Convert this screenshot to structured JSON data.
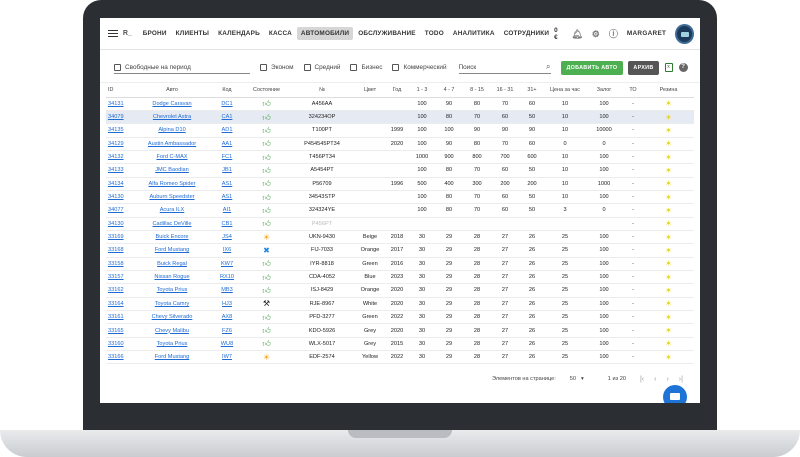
{
  "brand": "R_",
  "nav": [
    "БРОНИ",
    "КЛИЕНТЫ",
    "КАЛЕНДАРЬ",
    "КАССА",
    "АВТОМОБИЛИ",
    "ОБСЛУЖИВАНИЕ",
    "TODO",
    "АНАЛИТИКА",
    "СОТРУДНИКИ"
  ],
  "nav_active": "АВТОМОБИЛИ",
  "top_right": {
    "money": "0 €",
    "user": "MARGARET"
  },
  "filters": {
    "period_placeholder": "Свободные на период",
    "checkboxes": [
      "Эконом",
      "Средний",
      "Бизнес",
      "Коммерческий"
    ],
    "search_placeholder": "Поиск",
    "add_button": "ДОБАВИТЬ АВТО",
    "archive_button": "АРХИВ"
  },
  "columns": [
    "ID",
    "Авто",
    "Код",
    "Состояние",
    "№",
    "Цвет",
    "Год",
    "1 - 3",
    "4 - 7",
    "8 - 15",
    "16 - 31",
    "31+",
    "Цена за час",
    "Залог",
    "ТО",
    "Резина"
  ],
  "rows": [
    {
      "id": "34131",
      "auto": "Dodge Caravan",
      "code": "DC1",
      "state": "up",
      "num": "A456AA",
      "color": "",
      "year": "",
      "p1": "100",
      "p2": "90",
      "p3": "80",
      "p4": "70",
      "p5": "60",
      "hour": "10",
      "deposit": "100",
      "to": "-",
      "selected": false
    },
    {
      "id": "34079",
      "auto": "Chevrolet Astra",
      "code": "CA1",
      "state": "up",
      "num": "324234OP",
      "color": "",
      "year": "",
      "p1": "100",
      "p2": "80",
      "p3": "70",
      "p4": "60",
      "p5": "50",
      "hour": "10",
      "deposit": "100",
      "to": "-",
      "selected": true
    },
    {
      "id": "34135",
      "auto": "Alpina D10",
      "code": "AD1",
      "state": "up",
      "num": "T100PT",
      "color": "",
      "year": "1999",
      "p1": "100",
      "p2": "100",
      "p3": "90",
      "p4": "90",
      "p5": "90",
      "hour": "10",
      "deposit": "10000",
      "to": "-",
      "selected": false
    },
    {
      "id": "34129",
      "auto": "Austin Ambassador",
      "code": "AA1",
      "state": "up",
      "num": "P454545PT34",
      "color": "",
      "year": "2020",
      "p1": "100",
      "p2": "90",
      "p3": "80",
      "p4": "70",
      "p5": "60",
      "hour": "0",
      "deposit": "0",
      "to": "-",
      "selected": false
    },
    {
      "id": "34132",
      "auto": "Ford C-MAX",
      "code": "FC1",
      "state": "up",
      "num": "T456PT34",
      "color": "",
      "year": "",
      "p1": "1000",
      "p2": "900",
      "p3": "800",
      "p4": "700",
      "p5": "600",
      "hour": "10",
      "deposit": "100",
      "to": "-",
      "selected": false
    },
    {
      "id": "34133",
      "auto": "JMC Baodian",
      "code": "JB1",
      "state": "up",
      "num": "A5454PT",
      "color": "",
      "year": "",
      "p1": "100",
      "p2": "80",
      "p3": "70",
      "p4": "60",
      "p5": "50",
      "hour": "10",
      "deposit": "100",
      "to": "-",
      "selected": false
    },
    {
      "id": "34134",
      "auto": "Alfa Romeo Spider",
      "code": "AS1",
      "state": "up",
      "num": "P56709",
      "color": "",
      "year": "1996",
      "p1": "500",
      "p2": "400",
      "p3": "300",
      "p4": "200",
      "p5": "200",
      "hour": "10",
      "deposit": "1000",
      "to": "-",
      "selected": false
    },
    {
      "id": "34130",
      "auto": "Auburn Speedster",
      "code": "AS1",
      "state": "up",
      "num": "34543STP",
      "color": "",
      "year": "",
      "p1": "100",
      "p2": "80",
      "p3": "70",
      "p4": "60",
      "p5": "50",
      "hour": "10",
      "deposit": "100",
      "to": "-",
      "selected": false
    },
    {
      "id": "34077",
      "auto": "Acura ILX",
      "code": "AI1",
      "state": "up",
      "num": "324324YE",
      "color": "",
      "year": "",
      "p1": "100",
      "p2": "80",
      "p3": "70",
      "p4": "60",
      "p5": "50",
      "hour": "3",
      "deposit": "0",
      "to": "-",
      "selected": false
    },
    {
      "id": "34130",
      "auto": "Cadillac DeVille",
      "code": "CB1",
      "state": "up",
      "num": "P456PT",
      "color": "",
      "year": "",
      "p1": "",
      "p2": "",
      "p3": "",
      "p4": "",
      "p5": "",
      "hour": "",
      "deposit": "",
      "to": "-",
      "selected": false,
      "muted": true
    },
    {
      "id": "33169",
      "auto": "Buick Encore",
      "code": "JS4",
      "state": "sun",
      "num": "UKN-9430",
      "color": "Beige",
      "year": "2018",
      "p1": "30",
      "p2": "29",
      "p3": "28",
      "p4": "27",
      "p5": "26",
      "hour": "25",
      "deposit": "100",
      "to": "-",
      "selected": false
    },
    {
      "id": "33168",
      "auto": "Ford Mustang",
      "code": "IX6",
      "state": "wrench",
      "num": "FIJ-7033",
      "color": "Orange",
      "year": "2017",
      "p1": "30",
      "p2": "29",
      "p3": "28",
      "p4": "27",
      "p5": "26",
      "hour": "25",
      "deposit": "100",
      "to": "-",
      "selected": false
    },
    {
      "id": "33158",
      "auto": "Buick Regal",
      "code": "KW7",
      "state": "up",
      "num": "IYR-8818",
      "color": "Green",
      "year": "2016",
      "p1": "30",
      "p2": "29",
      "p3": "28",
      "p4": "27",
      "p5": "26",
      "hour": "25",
      "deposit": "100",
      "to": "-",
      "selected": false
    },
    {
      "id": "33157",
      "auto": "Nissan Rogue",
      "code": "RX10",
      "state": "up",
      "num": "CDA-4052",
      "color": "Blue",
      "year": "2023",
      "p1": "30",
      "p2": "29",
      "p3": "28",
      "p4": "27",
      "p5": "26",
      "hour": "25",
      "deposit": "100",
      "to": "-",
      "selected": false
    },
    {
      "id": "33162",
      "auto": "Toyota Prius",
      "code": "MB3",
      "state": "up",
      "num": "ISJ-8429",
      "color": "Orange",
      "year": "2020",
      "p1": "30",
      "p2": "29",
      "p3": "28",
      "p4": "27",
      "p5": "26",
      "hour": "25",
      "deposit": "100",
      "to": "-",
      "selected": false
    },
    {
      "id": "33164",
      "auto": "Toyota Camry",
      "code": "HJ3",
      "state": "tools",
      "num": "RJE-8967",
      "color": "White",
      "year": "2020",
      "p1": "30",
      "p2": "29",
      "p3": "28",
      "p4": "27",
      "p5": "26",
      "hour": "25",
      "deposit": "100",
      "to": "-",
      "selected": false
    },
    {
      "id": "33161",
      "auto": "Chevy Silverado",
      "code": "AX8",
      "state": "up",
      "num": "PFD-3277",
      "color": "Green",
      "year": "2022",
      "p1": "30",
      "p2": "29",
      "p3": "28",
      "p4": "27",
      "p5": "26",
      "hour": "25",
      "deposit": "100",
      "to": "-",
      "selected": false
    },
    {
      "id": "33165",
      "auto": "Chevy Malibu",
      "code": "FZ6",
      "state": "up",
      "num": "KDO-5926",
      "color": "Grey",
      "year": "2020",
      "p1": "30",
      "p2": "29",
      "p3": "28",
      "p4": "27",
      "p5": "26",
      "hour": "25",
      "deposit": "100",
      "to": "-",
      "selected": false
    },
    {
      "id": "33160",
      "auto": "Toyota Prius",
      "code": "WU8",
      "state": "up",
      "num": "WLX-5017",
      "color": "Grey",
      "year": "2015",
      "p1": "30",
      "p2": "29",
      "p3": "28",
      "p4": "27",
      "p5": "26",
      "hour": "25",
      "deposit": "100",
      "to": "-",
      "selected": false
    },
    {
      "id": "33166",
      "auto": "Ford Mustang",
      "code": "IW7",
      "state": "sun",
      "num": "EDF-2574",
      "color": "Yellow",
      "year": "2022",
      "p1": "30",
      "p2": "29",
      "p3": "28",
      "p4": "27",
      "p5": "26",
      "hour": "25",
      "deposit": "100",
      "to": "-",
      "selected": false
    }
  ],
  "pager": {
    "label": "Элементов на странице:",
    "size": "50",
    "range": "1 из 20"
  },
  "icons": {
    "state_up": "thumb-up-icon",
    "state_sun": "sun-icon",
    "state_wrench": "wrench-icon",
    "state_tools": "tools-icon",
    "tires": "star-icon"
  },
  "colors": {
    "accent_green": "#4caf50",
    "link_blue": "#1e6bd6",
    "chat_blue": "#1e74d6",
    "selected_row": "#e6eaf2"
  }
}
